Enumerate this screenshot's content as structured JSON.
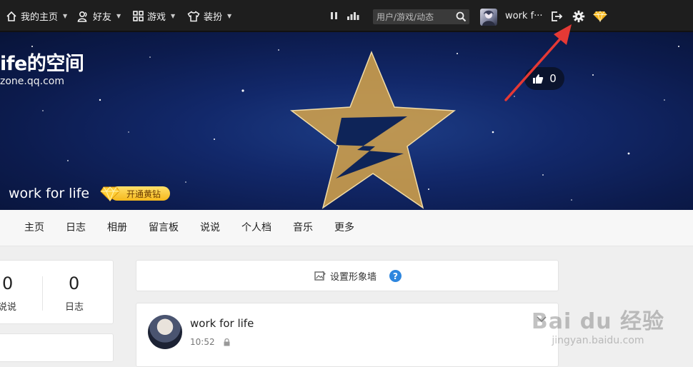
{
  "topbar": {
    "nav": [
      {
        "label": "我的主页",
        "icon": "home-icon"
      },
      {
        "label": "好友",
        "icon": "friends-icon"
      },
      {
        "label": "游戏",
        "icon": "grid-icon"
      },
      {
        "label": "装扮",
        "icon": "shirt-icon"
      }
    ],
    "search_placeholder": "用户/游戏/动态",
    "username": "work f···"
  },
  "banner": {
    "title": "ife的空间",
    "url": "zone.qq.com",
    "likes": "0",
    "owner_name": "work for life",
    "vip_label": "开通黄钻"
  },
  "tabs": [
    "主页",
    "日志",
    "相册",
    "留言板",
    "说说",
    "个人档",
    "音乐",
    "更多"
  ],
  "stats": [
    {
      "value": "0",
      "label": "说说"
    },
    {
      "value": "0",
      "label": "日志"
    }
  ],
  "setup_card": {
    "label": "设置形象墙",
    "help": "?"
  },
  "post": {
    "author": "work for life",
    "time": "10:52"
  },
  "watermark": {
    "brand": "Bai du 经验",
    "url": "jingyan.baidu.com"
  },
  "colors": {
    "topbar": "#1e1e1e",
    "accent": "#2e86de",
    "vip": "#f5b81c",
    "annotation_arrow": "#e53935"
  }
}
